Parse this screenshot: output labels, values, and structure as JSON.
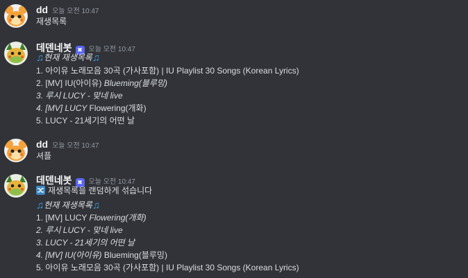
{
  "messages": [
    {
      "author": "dd",
      "timestamp": "오늘 오전 10:47",
      "text": "재생목록"
    },
    {
      "author": "데덴네봇",
      "bot_badge": "✖",
      "timestamp": "오늘 오전 10:47",
      "heading_icon": "♫",
      "heading": "현재 재생목록",
      "tracks": [
        {
          "num": "1.",
          "title": "아이유 노래모음 30곡 (가사포함) | IU Playlist 30 Songs (Korean Lyrics)"
        },
        {
          "num": "2.",
          "title_a": "[MV] IU(아이유)",
          "title_b": "Blueming(블루밍)"
        },
        {
          "num": "3.",
          "title": "루시 LUCY - 맞네 live"
        },
        {
          "num": "4.",
          "title_a": "[MV] LUCY",
          "title_b": "Flowering(개화)"
        },
        {
          "num": "5.",
          "title": "LUCY - 21세기의 어떤 날"
        }
      ]
    },
    {
      "author": "dd",
      "timestamp": "오늘 오전 10:47",
      "text": "셔플"
    },
    {
      "author": "데덴네봇",
      "bot_badge": "✖",
      "timestamp": "오늘 오전 10:47",
      "shuffle_icon": "shuffle-icon",
      "shuffle_text": "재생목록을 랜덤하게 섞습니다",
      "heading_icon": "♫",
      "heading": "현재 재생목록",
      "tracks": [
        {
          "num": "1.",
          "title_a": "[MV] LUCY",
          "title_b": "Flowering(개화)"
        },
        {
          "num": "2.",
          "title": "루시 LUCY - 맞네 live"
        },
        {
          "num": "3.",
          "title": "LUCY - 21세기의 어떤 날"
        },
        {
          "num": "4.",
          "title_a": "[MV] IU(아이유)",
          "title_b": "Blueming(블루밍)"
        },
        {
          "num": "5.",
          "title": "아이유 노래모음 30곡 (가사포함) | IU Playlist 30 Songs (Korean Lyrics)"
        }
      ]
    }
  ],
  "colors": {
    "background": "#313338",
    "username": "#f2f3f5",
    "text": "#dbdee1",
    "timestamp": "#949ba4",
    "bot_badge": "#5865f2",
    "note": "#3b9de5"
  },
  "icons": {
    "user_avatar": "dedenne-avatar-icon",
    "bot_avatar": "dedenne-bot-avatar-icon",
    "heading": "musical-notes-icon",
    "shuffle": "shuffle-icon"
  }
}
